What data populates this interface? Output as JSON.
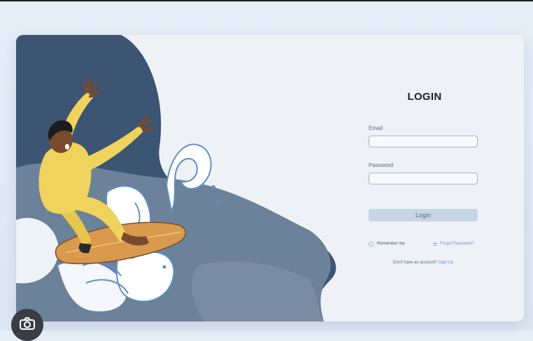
{
  "login": {
    "title": "LOGIN",
    "email_label": "Email",
    "email_value": "",
    "password_label": "Password",
    "password_value": "",
    "login_button": "Login",
    "remember_label": "Remember me",
    "forgot_label": "Forgot Password?",
    "signup_prompt": "Don't have an account?",
    "signup_link": "Sign Up"
  },
  "icons": {
    "lock": "lock-icon",
    "lens": "lens-search-icon"
  },
  "colors": {
    "page_background": "#e6eef8",
    "card_background": "#eef2f7",
    "wave_dark": "#3b5573",
    "wave_mid": "#6c819a",
    "suit": "#efd35c",
    "board": "#d99a4d",
    "button_fill": "#c8d5e7",
    "link": "#6b8fd0"
  }
}
